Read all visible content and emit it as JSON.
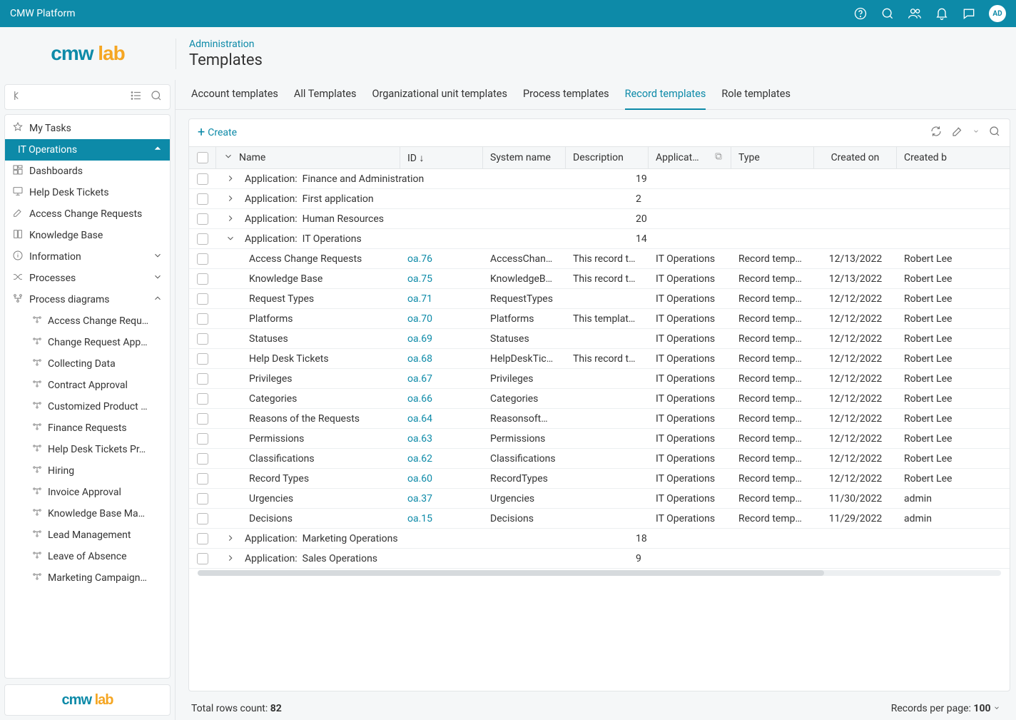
{
  "topbar": {
    "title": "CMW Platform",
    "avatar_initials": "AD"
  },
  "logo": {
    "left": "cmw",
    "right": "lab"
  },
  "breadcrumb": "Administration",
  "page_title": "Templates",
  "sidebar": {
    "items": [
      {
        "label": "My Tasks",
        "icon": "star",
        "chev": ""
      },
      {
        "label": "IT Operations",
        "icon": "",
        "chev": "up",
        "active": true
      },
      {
        "label": "Dashboards",
        "icon": "dashboard",
        "chev": ""
      },
      {
        "label": "Help Desk Tickets",
        "icon": "monitor",
        "chev": ""
      },
      {
        "label": "Access Change Requests",
        "icon": "edit",
        "chev": ""
      },
      {
        "label": "Knowledge Base",
        "icon": "book",
        "chev": ""
      },
      {
        "label": "Information",
        "icon": "info",
        "chev": "down"
      },
      {
        "label": "Processes",
        "icon": "shuffle",
        "chev": "down"
      },
      {
        "label": "Process diagrams",
        "icon": "diagram",
        "chev": "up"
      }
    ],
    "sub_items": [
      "Access Change Requ…",
      "Change Request App…",
      "Collecting Data",
      "Contract Approval",
      "Customized Product …",
      "Finance Requests",
      "Help Desk Tickets Pr…",
      "Hiring",
      "Invoice Approval",
      "Knowledge Base Ma…",
      "Lead Management",
      "Leave of Absence",
      "Marketing Campaign…"
    ]
  },
  "tabs": [
    {
      "label": "Account templates",
      "active": false
    },
    {
      "label": "All Templates",
      "active": false
    },
    {
      "label": "Organizational unit templates",
      "active": false
    },
    {
      "label": "Process templates",
      "active": false
    },
    {
      "label": "Record templates",
      "active": true
    },
    {
      "label": "Role templates",
      "active": false
    }
  ],
  "toolbar": {
    "create_label": "Create"
  },
  "columns": {
    "name": "Name",
    "id": "ID ↓",
    "sys": "System name",
    "desc": "Description",
    "app": "Applicat…",
    "type": "Type",
    "created": "Created on",
    "by": "Created b"
  },
  "group_prefix": "Application:",
  "groups_before": [
    {
      "name": "Finance and Administration",
      "count": "19"
    },
    {
      "name": "First application",
      "count": "2"
    },
    {
      "name": "Human Resources",
      "count": "20"
    }
  ],
  "open_group": {
    "name": "IT Operations",
    "count": "14"
  },
  "rows": [
    {
      "name": "Access Change Requests",
      "id": "oa.76",
      "sys": "AccessChan…",
      "desc": "This record t…",
      "app": "IT Operations",
      "type": "Record temp…",
      "created": "12/13/2022",
      "by": "Robert Lee"
    },
    {
      "name": "Knowledge Base",
      "id": "oa.75",
      "sys": "KnowledgeB…",
      "desc": "This record t…",
      "app": "IT Operations",
      "type": "Record temp…",
      "created": "12/13/2022",
      "by": "Robert Lee"
    },
    {
      "name": "Request Types",
      "id": "oa.71",
      "sys": "RequestTypes",
      "desc": "",
      "app": "IT Operations",
      "type": "Record temp…",
      "created": "12/12/2022",
      "by": "Robert Lee"
    },
    {
      "name": "Platforms",
      "id": "oa.70",
      "sys": "Platforms",
      "desc": "This templat…",
      "app": "IT Operations",
      "type": "Record temp…",
      "created": "12/12/2022",
      "by": "Robert Lee"
    },
    {
      "name": "Statuses",
      "id": "oa.69",
      "sys": "Statuses",
      "desc": "",
      "app": "IT Operations",
      "type": "Record temp…",
      "created": "12/12/2022",
      "by": "Robert Lee"
    },
    {
      "name": "Help Desk Tickets",
      "id": "oa.68",
      "sys": "HelpDeskTic…",
      "desc": "This record t…",
      "app": "IT Operations",
      "type": "Record temp…",
      "created": "12/12/2022",
      "by": "Robert Lee"
    },
    {
      "name": "Privileges",
      "id": "oa.67",
      "sys": "Privileges",
      "desc": "",
      "app": "IT Operations",
      "type": "Record temp…",
      "created": "12/12/2022",
      "by": "Robert Lee"
    },
    {
      "name": "Categories",
      "id": "oa.66",
      "sys": "Categories",
      "desc": "",
      "app": "IT Operations",
      "type": "Record temp…",
      "created": "12/12/2022",
      "by": "Robert Lee"
    },
    {
      "name": "Reasons of the Requests",
      "id": "oa.64",
      "sys": "Reasonsoft…",
      "desc": "",
      "app": "IT Operations",
      "type": "Record temp…",
      "created": "12/12/2022",
      "by": "Robert Lee"
    },
    {
      "name": "Permissions",
      "id": "oa.63",
      "sys": "Permissions",
      "desc": "",
      "app": "IT Operations",
      "type": "Record temp…",
      "created": "12/12/2022",
      "by": "Robert Lee"
    },
    {
      "name": "Classifications",
      "id": "oa.62",
      "sys": "Classifications",
      "desc": "",
      "app": "IT Operations",
      "type": "Record temp…",
      "created": "12/12/2022",
      "by": "Robert Lee"
    },
    {
      "name": "Record Types",
      "id": "oa.60",
      "sys": "RecordTypes",
      "desc": "",
      "app": "IT Operations",
      "type": "Record temp…",
      "created": "12/12/2022",
      "by": "Robert Lee"
    },
    {
      "name": "Urgencies",
      "id": "oa.37",
      "sys": "Urgencies",
      "desc": "",
      "app": "IT Operations",
      "type": "Record temp…",
      "created": "11/30/2022",
      "by": "admin"
    },
    {
      "name": "Decisions",
      "id": "oa.15",
      "sys": "Decisions",
      "desc": "",
      "app": "IT Operations",
      "type": "Record temp…",
      "created": "11/29/2022",
      "by": "admin"
    }
  ],
  "groups_after": [
    {
      "name": "Marketing Operations",
      "count": "18"
    },
    {
      "name": "Sales Operations",
      "count": "9"
    }
  ],
  "footer": {
    "total_label": "Total rows count:",
    "total_value": "82",
    "perpage_label": "Records per page:",
    "perpage_value": "100"
  }
}
